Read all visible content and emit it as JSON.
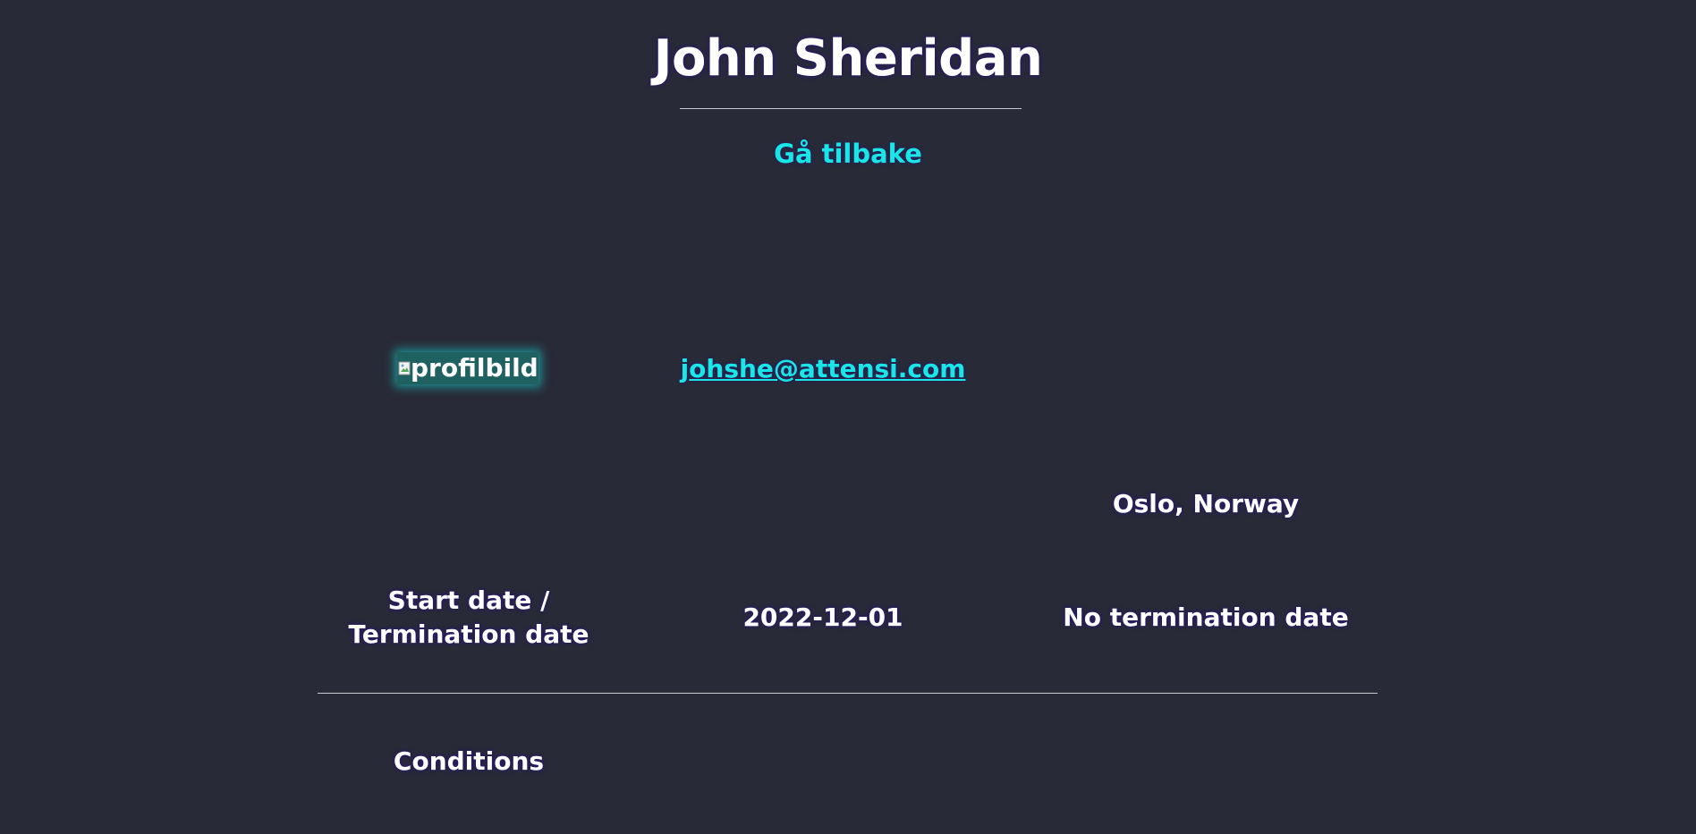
{
  "header": {
    "title": "John Sheridan",
    "back_label": "Gå tilbake"
  },
  "profile": {
    "image_alt": "profilbilde",
    "email": "johshe@attensi.com",
    "location": "Oslo, Norway"
  },
  "dates": {
    "label": "Start date / Termination date",
    "start_date": "2022-12-01",
    "termination_date": "No termination date"
  },
  "sections": {
    "conditions_label": "Conditions"
  },
  "colors": {
    "background": "#282b37",
    "text": "#ffffff",
    "accent_link": "#19e6e6",
    "divider": "#c8cad2"
  },
  "icons": {
    "broken_image": "broken-image-icon"
  }
}
